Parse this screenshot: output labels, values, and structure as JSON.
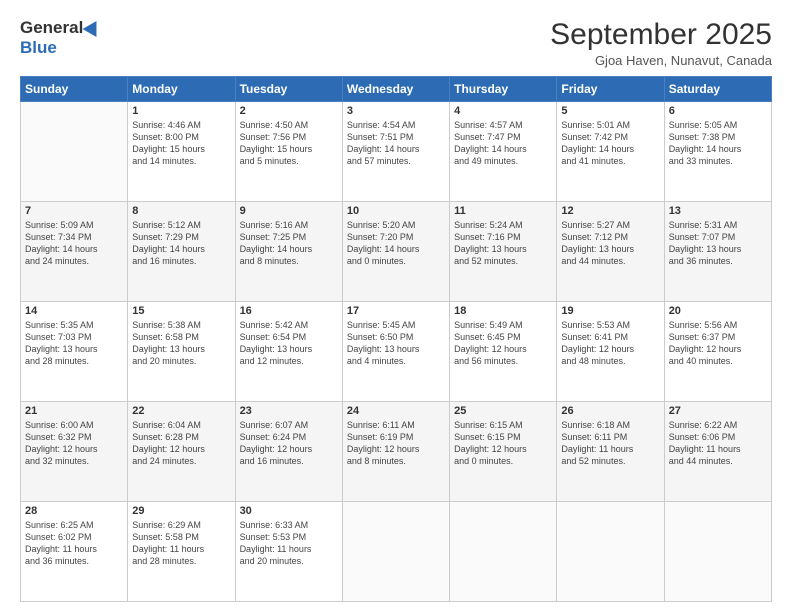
{
  "logo": {
    "general": "General",
    "blue": "Blue"
  },
  "header": {
    "title": "September 2025",
    "subtitle": "Gjoa Haven, Nunavut, Canada"
  },
  "weekdays": [
    "Sunday",
    "Monday",
    "Tuesday",
    "Wednesday",
    "Thursday",
    "Friday",
    "Saturday"
  ],
  "weeks": [
    [
      {
        "day": "",
        "info": ""
      },
      {
        "day": "1",
        "info": "Sunrise: 4:46 AM\nSunset: 8:00 PM\nDaylight: 15 hours\nand 14 minutes."
      },
      {
        "day": "2",
        "info": "Sunrise: 4:50 AM\nSunset: 7:56 PM\nDaylight: 15 hours\nand 5 minutes."
      },
      {
        "day": "3",
        "info": "Sunrise: 4:54 AM\nSunset: 7:51 PM\nDaylight: 14 hours\nand 57 minutes."
      },
      {
        "day": "4",
        "info": "Sunrise: 4:57 AM\nSunset: 7:47 PM\nDaylight: 14 hours\nand 49 minutes."
      },
      {
        "day": "5",
        "info": "Sunrise: 5:01 AM\nSunset: 7:42 PM\nDaylight: 14 hours\nand 41 minutes."
      },
      {
        "day": "6",
        "info": "Sunrise: 5:05 AM\nSunset: 7:38 PM\nDaylight: 14 hours\nand 33 minutes."
      }
    ],
    [
      {
        "day": "7",
        "info": "Sunrise: 5:09 AM\nSunset: 7:34 PM\nDaylight: 14 hours\nand 24 minutes."
      },
      {
        "day": "8",
        "info": "Sunrise: 5:12 AM\nSunset: 7:29 PM\nDaylight: 14 hours\nand 16 minutes."
      },
      {
        "day": "9",
        "info": "Sunrise: 5:16 AM\nSunset: 7:25 PM\nDaylight: 14 hours\nand 8 minutes."
      },
      {
        "day": "10",
        "info": "Sunrise: 5:20 AM\nSunset: 7:20 PM\nDaylight: 14 hours\nand 0 minutes."
      },
      {
        "day": "11",
        "info": "Sunrise: 5:24 AM\nSunset: 7:16 PM\nDaylight: 13 hours\nand 52 minutes."
      },
      {
        "day": "12",
        "info": "Sunrise: 5:27 AM\nSunset: 7:12 PM\nDaylight: 13 hours\nand 44 minutes."
      },
      {
        "day": "13",
        "info": "Sunrise: 5:31 AM\nSunset: 7:07 PM\nDaylight: 13 hours\nand 36 minutes."
      }
    ],
    [
      {
        "day": "14",
        "info": "Sunrise: 5:35 AM\nSunset: 7:03 PM\nDaylight: 13 hours\nand 28 minutes."
      },
      {
        "day": "15",
        "info": "Sunrise: 5:38 AM\nSunset: 6:58 PM\nDaylight: 13 hours\nand 20 minutes."
      },
      {
        "day": "16",
        "info": "Sunrise: 5:42 AM\nSunset: 6:54 PM\nDaylight: 13 hours\nand 12 minutes."
      },
      {
        "day": "17",
        "info": "Sunrise: 5:45 AM\nSunset: 6:50 PM\nDaylight: 13 hours\nand 4 minutes."
      },
      {
        "day": "18",
        "info": "Sunrise: 5:49 AM\nSunset: 6:45 PM\nDaylight: 12 hours\nand 56 minutes."
      },
      {
        "day": "19",
        "info": "Sunrise: 5:53 AM\nSunset: 6:41 PM\nDaylight: 12 hours\nand 48 minutes."
      },
      {
        "day": "20",
        "info": "Sunrise: 5:56 AM\nSunset: 6:37 PM\nDaylight: 12 hours\nand 40 minutes."
      }
    ],
    [
      {
        "day": "21",
        "info": "Sunrise: 6:00 AM\nSunset: 6:32 PM\nDaylight: 12 hours\nand 32 minutes."
      },
      {
        "day": "22",
        "info": "Sunrise: 6:04 AM\nSunset: 6:28 PM\nDaylight: 12 hours\nand 24 minutes."
      },
      {
        "day": "23",
        "info": "Sunrise: 6:07 AM\nSunset: 6:24 PM\nDaylight: 12 hours\nand 16 minutes."
      },
      {
        "day": "24",
        "info": "Sunrise: 6:11 AM\nSunset: 6:19 PM\nDaylight: 12 hours\nand 8 minutes."
      },
      {
        "day": "25",
        "info": "Sunrise: 6:15 AM\nSunset: 6:15 PM\nDaylight: 12 hours\nand 0 minutes."
      },
      {
        "day": "26",
        "info": "Sunrise: 6:18 AM\nSunset: 6:11 PM\nDaylight: 11 hours\nand 52 minutes."
      },
      {
        "day": "27",
        "info": "Sunrise: 6:22 AM\nSunset: 6:06 PM\nDaylight: 11 hours\nand 44 minutes."
      }
    ],
    [
      {
        "day": "28",
        "info": "Sunrise: 6:25 AM\nSunset: 6:02 PM\nDaylight: 11 hours\nand 36 minutes."
      },
      {
        "day": "29",
        "info": "Sunrise: 6:29 AM\nSunset: 5:58 PM\nDaylight: 11 hours\nand 28 minutes."
      },
      {
        "day": "30",
        "info": "Sunrise: 6:33 AM\nSunset: 5:53 PM\nDaylight: 11 hours\nand 20 minutes."
      },
      {
        "day": "",
        "info": ""
      },
      {
        "day": "",
        "info": ""
      },
      {
        "day": "",
        "info": ""
      },
      {
        "day": "",
        "info": ""
      }
    ]
  ]
}
